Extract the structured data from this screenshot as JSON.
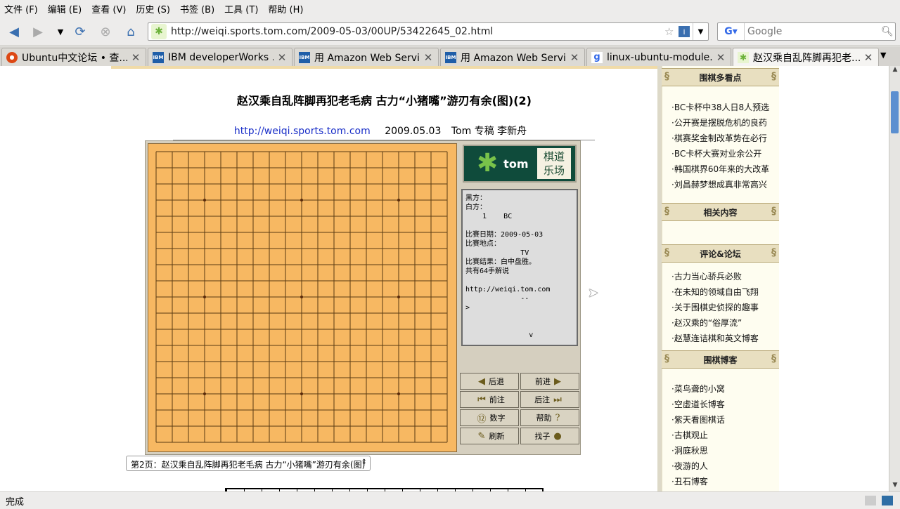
{
  "menu": [
    "文件 (F)",
    "编辑 (E)",
    "查看 (V)",
    "历史 (S)",
    "书签 (B)",
    "工具 (T)",
    "帮助 (H)"
  ],
  "nav": {
    "url": "http://weiqi.sports.tom.com/2009-05-03/00UP/53422645_02.html",
    "search_placeholder": "Google"
  },
  "tabs": [
    {
      "title": "Ubuntu中文论坛 • 查..."
    },
    {
      "title": "IBM developerWorks ..."
    },
    {
      "title": "用 Amazon Web Servi..."
    },
    {
      "title": "用 Amazon Web Servi..."
    },
    {
      "title": "linux-ubuntu-module..."
    },
    {
      "title": "赵汉乘自乱阵脚再犯老..."
    }
  ],
  "article": {
    "title": "赵汉乘自乱阵脚再犯老毛病 古力“小猪嘴”游刃有余(图)(2)",
    "source_link": "http://weiqi.sports.tom.com",
    "date": "2009.05.03",
    "author": "Tom 专稿 李新舟",
    "page_select": "第2页：赵汉乘自乱阵脚再犯老毛病 古力“小猪嘴”游刃有余(图)"
  },
  "board": {
    "logo_text": "tom",
    "logo_callig": "棋道 乐场",
    "info_lines": "黑方：\n白方：\n    1    BC\n\n比赛日期：2009-05-03\n比赛地点：\n             TV\n比赛结果：白中盘胜。\n共有64手解说\n\nhttp://weiqi.tom.com\n             --\n>\n\n\n               v",
    "controls": [
      {
        "label": "后退",
        "icon": "◀"
      },
      {
        "label": "前进",
        "icon": "▶"
      },
      {
        "label": "前注",
        "icon": "⏮"
      },
      {
        "label": "后注",
        "icon": "⏭"
      },
      {
        "label": "数字",
        "icon": "⑫"
      },
      {
        "label": "帮助",
        "icon": "?"
      },
      {
        "label": "刷新",
        "icon": "✎"
      },
      {
        "label": "找子",
        "icon": "●"
      }
    ]
  },
  "sidebar": {
    "sections": [
      {
        "title": "围棋多看点"
      },
      {
        "title": "相关内容"
      },
      {
        "title": "评论&论坛"
      },
      {
        "title": "围棋博客"
      }
    ],
    "links1": [
      "·BC卡杯中38人日8人预选",
      "·公开赛是摆脱危机的良药",
      "·棋赛奖金制改革势在必行",
      "·BC卡杯大赛对业余公开",
      "·韩国棋界60年来的大改革",
      "·刘昌赫梦想成真非常高兴"
    ],
    "links2": [
      "·古力当心骄兵必败",
      "·在未知的领域自由飞翔",
      "·关于围棋史侦探的趣事",
      "·赵汉乘的“俗厚流”",
      "·赵慧连诘棋和英文博客"
    ],
    "links3": [
      "·菜鸟聋的小窝",
      "·空虚道长博客",
      "·紫天看图棋话",
      "·古棋观止",
      "·洞庭秋思",
      "·夜游的人",
      "·丑石博客"
    ]
  },
  "status": "完成"
}
